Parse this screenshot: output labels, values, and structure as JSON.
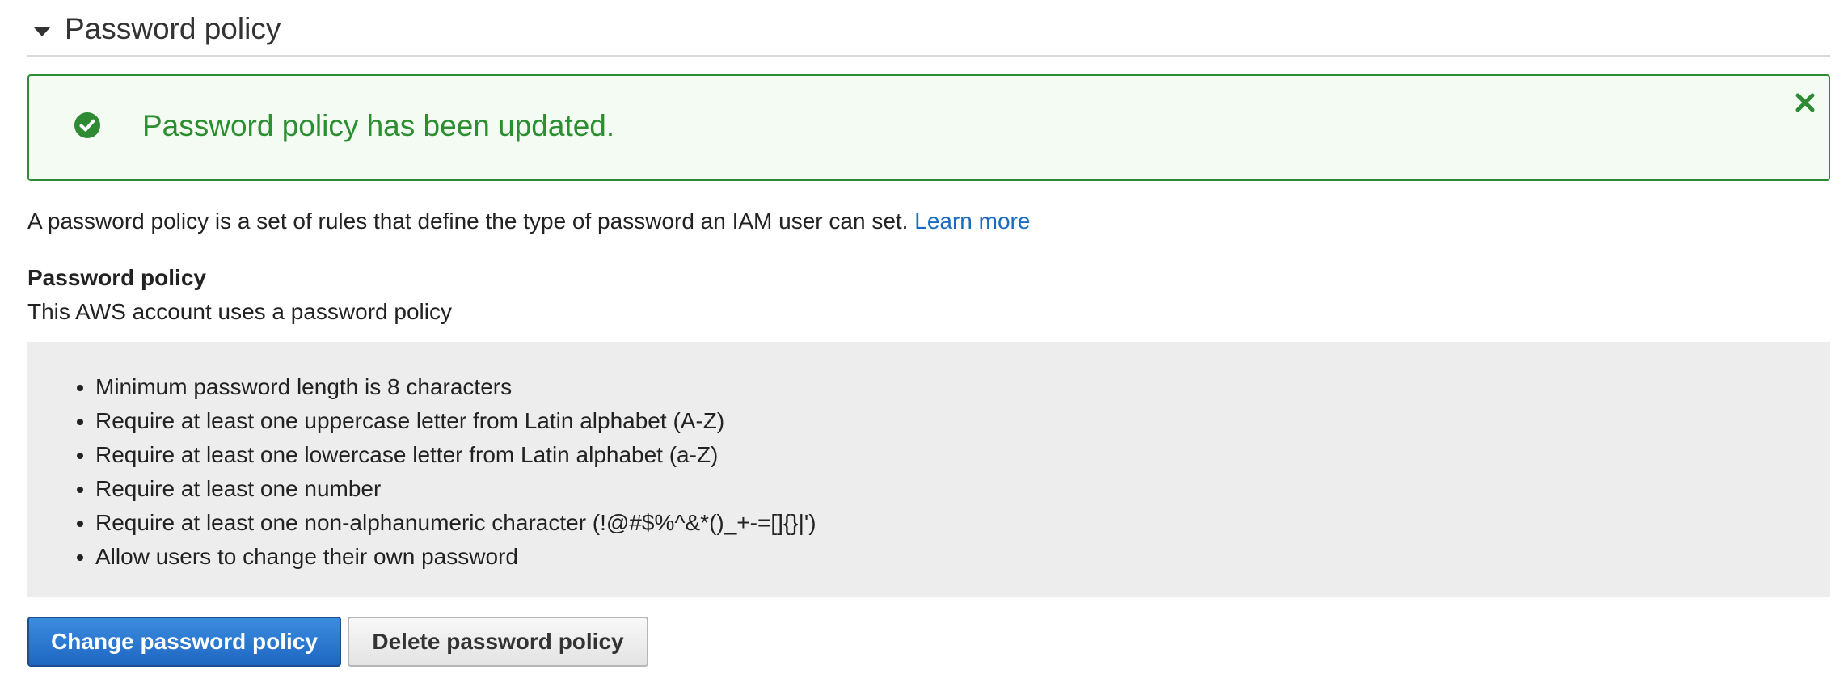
{
  "section": {
    "title": "Password policy",
    "expanded": true
  },
  "alert": {
    "message": "Password policy has been updated.",
    "type": "success",
    "color": "#2b8e2f"
  },
  "description": {
    "text": "A password policy is a set of rules that define the type of password an IAM user can set.",
    "link_label": "Learn more",
    "link_color": "#1a6bbf"
  },
  "policy": {
    "heading": "Password policy",
    "subtext": "This AWS account uses a password policy",
    "rules": [
      "Minimum password length is 8 characters",
      "Require at least one uppercase letter from Latin alphabet (A-Z)",
      "Require at least one lowercase letter from Latin alphabet (a-Z)",
      "Require at least one number",
      "Require at least one non-alphanumeric character (!@#$%^&*()_+-=[]{}|')",
      "Allow users to change their own password"
    ]
  },
  "buttons": {
    "change_label": "Change password policy",
    "delete_label": "Delete password policy",
    "primary_color": "#1f66c1"
  },
  "icons": {
    "caret": "caret-down-icon",
    "success": "check-circle-icon",
    "close": "close-icon"
  }
}
